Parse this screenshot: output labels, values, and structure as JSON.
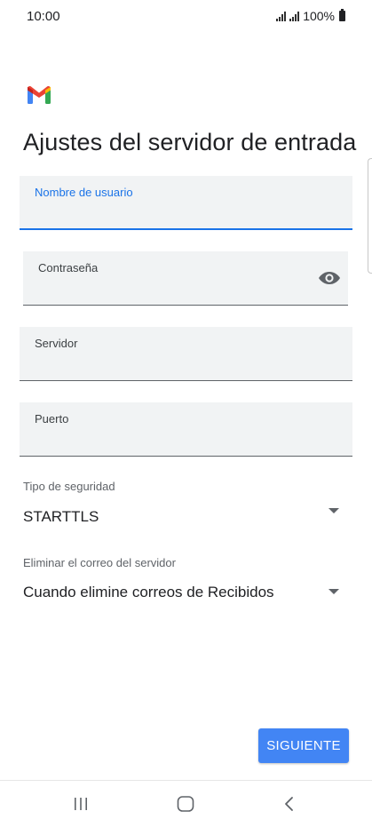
{
  "status_bar": {
    "time": "10:00",
    "battery": "100%"
  },
  "header": {
    "logo_icon": "gmail-icon",
    "title": "Ajustes del servidor de entrada"
  },
  "form": {
    "username": {
      "label": "Nombre de usuario",
      "value": "",
      "focused": true
    },
    "password": {
      "label": "Contraseña",
      "value": "",
      "toggle_icon": "eye-icon"
    },
    "server": {
      "label": "Servidor",
      "value": ""
    },
    "port": {
      "label": "Puerto",
      "value": ""
    },
    "security_type": {
      "label": "Tipo de seguridad",
      "value": "STARTTLS"
    },
    "delete_from_server": {
      "label": "Eliminar el correo del servidor",
      "value": "Cuando elimine correos de Recibidos"
    }
  },
  "actions": {
    "next_label": "SIGUIENTE"
  },
  "colors": {
    "accent": "#1a73e8",
    "button": "#4285f4",
    "field_bg": "#f1f3f4"
  },
  "nav_bar": {
    "recents_icon": "recents-icon",
    "home_icon": "home-icon",
    "back_icon": "back-icon"
  }
}
